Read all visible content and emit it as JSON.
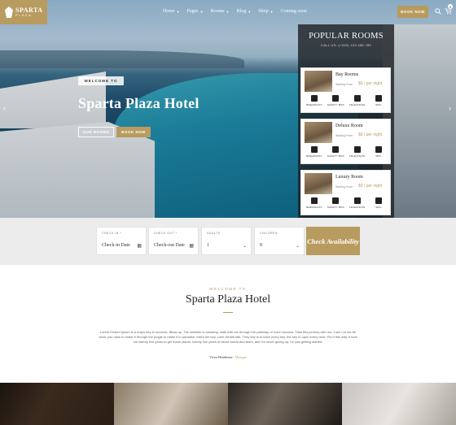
{
  "brand": {
    "name": "SPARTA",
    "tagline": "PLAZA",
    "accent": "#b89b5e"
  },
  "nav": {
    "items": [
      {
        "label": "Home",
        "has_dropdown": true
      },
      {
        "label": "Pages",
        "has_dropdown": true
      },
      {
        "label": "Rooms",
        "has_dropdown": true
      },
      {
        "label": "Blog",
        "has_dropdown": true
      },
      {
        "label": "Shop",
        "has_dropdown": true
      },
      {
        "label": "Coming soon",
        "has_dropdown": false
      }
    ],
    "book_now": "BOOK NOW",
    "cart_count": "0"
  },
  "hero": {
    "badge": "WELCOME TO",
    "title": "Sparta Plaza Hotel",
    "btn_rooms": "OUR ROOMS",
    "btn_book": "BOOK NOW",
    "prev_arrow": "‹",
    "next_arrow": "›"
  },
  "popular": {
    "title": "POPULAR ROOMS",
    "call": "CALL US: (+200) 123 456 789",
    "rooms": [
      {
        "name": "Bay Rooms",
        "starting": "Starting From :",
        "price": "$0 / per night",
        "amenities": [
          "BREAKFAST",
          "SAFETY BOX",
          "TELEVISION",
          "WIFI"
        ]
      },
      {
        "name": "Deluxe Room",
        "starting": "Starting From :",
        "price": "$0 / per night",
        "amenities": [
          "BREAKFAST",
          "SAFETY BOX",
          "TELEVISION",
          "WIFI"
        ]
      },
      {
        "name": "Luxury Room",
        "starting": "Starting From :",
        "price": "$0 / per night",
        "amenities": [
          "BREAKFAST",
          "SAFETY BOX",
          "TELEVISION",
          "WIFI"
        ]
      }
    ]
  },
  "booking": {
    "check_in": {
      "label": "CHECK IN *",
      "value": "Check-in Date"
    },
    "check_out": {
      "label": "CHECK OUT *",
      "value": "Check-out Date"
    },
    "adults": {
      "label": "ADULTS",
      "value": "1"
    },
    "children": {
      "label": "CHILDREN",
      "value": "0"
    },
    "submit": "Check Availability"
  },
  "about": {
    "welcome": "WELCOME TO",
    "title": "Sparta Plaza Hotel",
    "text": "Lorem Khaled Ipsum is a major key to success. Bless up. The weather is amazing, walk with me through the pathway of more success. Take this journey with me, Lion! Let me be clear, you have to make it through the jungle to make it to paradise, that's the key, Lion! Wraith talk. They key is to have every key, the key to open every door. Put it this way, it took me twenty five years to get these plants, twenty five years of blood sweat and tears, and I'm never giving up, I'm just getting started.",
    "author": "Victor Henderson",
    "role": "Manager"
  }
}
